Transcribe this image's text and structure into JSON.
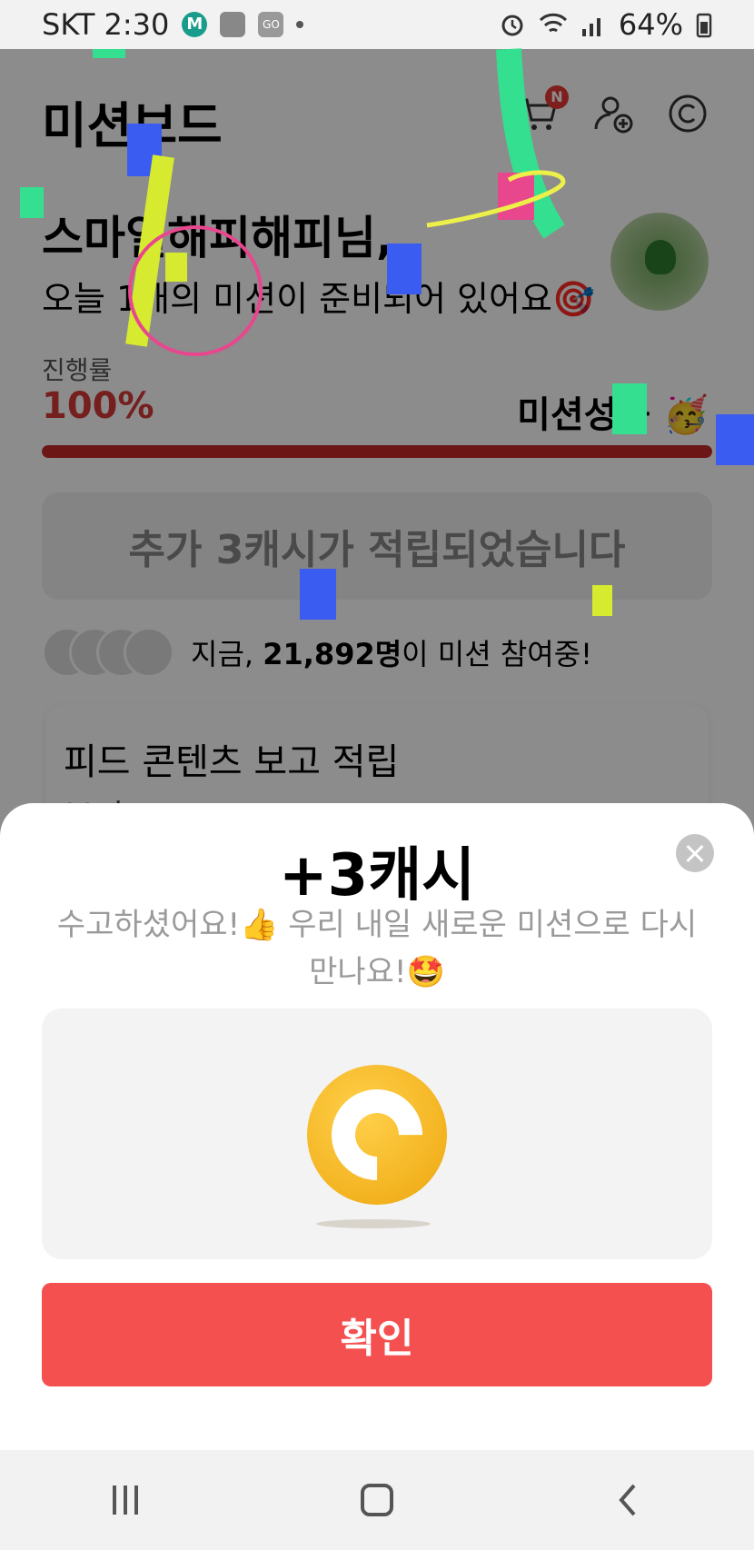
{
  "status_bar": {
    "carrier_time": "SKT 2:30",
    "battery": "64%",
    "icons": [
      "m-app-icon",
      "record-icon",
      "go-icon",
      "dot-icon",
      "alarm-icon",
      "wifi-icon",
      "signal-icon",
      "battery-icon"
    ]
  },
  "header": {
    "title": "미션보드",
    "cart_badge": "N",
    "icons": [
      "cart-icon",
      "add-friend-icon",
      "cash-icon"
    ]
  },
  "greeting": {
    "name_line": "스마일해피해피님,",
    "sub_line": "오늘 1개의 미션이 준비되어 있어요🎯"
  },
  "progress": {
    "label": "진행률",
    "value_text": "100%",
    "value": 1.0,
    "status": "미션성공 🥳"
  },
  "notice": {
    "text": "추가 3캐시가 적립되었습니다"
  },
  "participants": {
    "prefix": "지금, ",
    "count": "21,892명",
    "suffix": "이 미션 참여중!"
  },
  "feed_card": {
    "title": "피드 콘텐츠 보고 적립",
    "subtitle": "보기"
  },
  "sheet": {
    "title": "+3캐시",
    "message": "수고하셨어요!👍 우리 내일 새로운 미션으로 다시 만나요!🤩",
    "confirm_label": "확인",
    "coin_icon": "cash-coin-icon"
  },
  "nav_bar": {
    "icons": [
      "recent-apps-icon",
      "home-icon",
      "back-icon"
    ]
  },
  "colors": {
    "accent_red": "#f55050",
    "progress_red": "#c62828",
    "coin_yellow": "#f3b320"
  }
}
